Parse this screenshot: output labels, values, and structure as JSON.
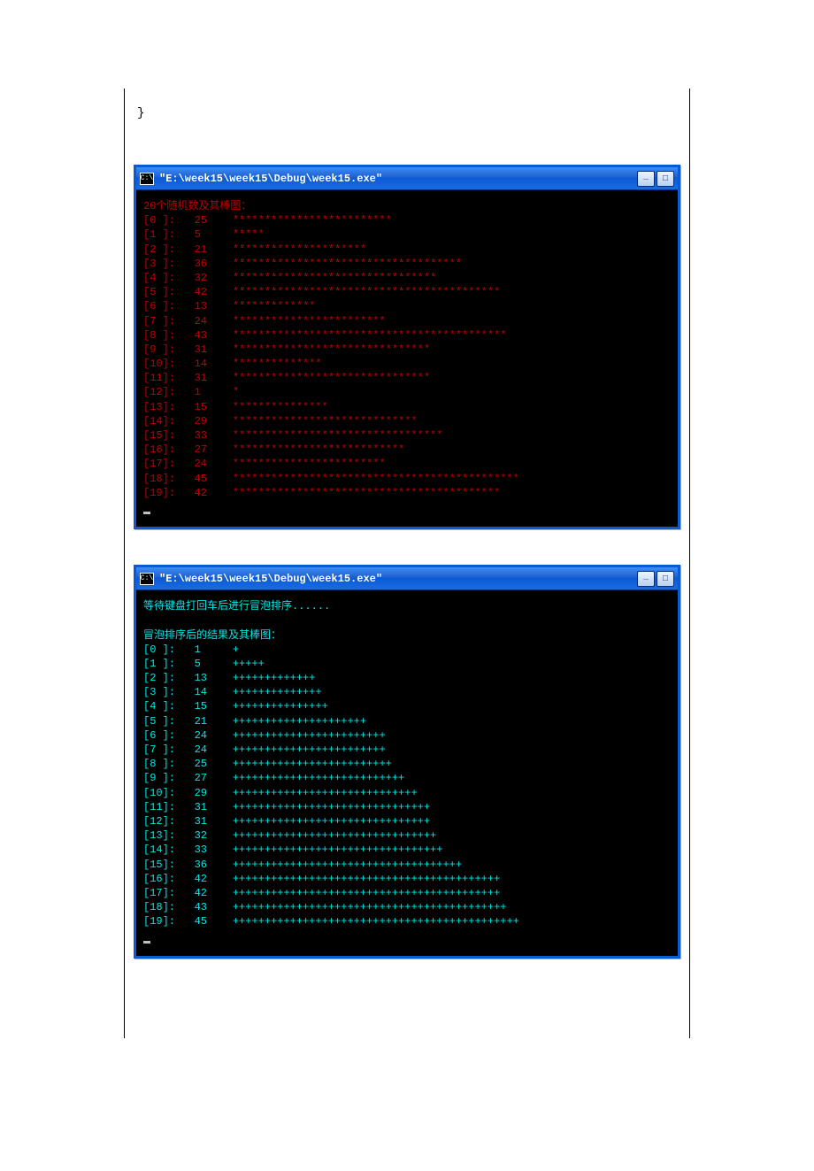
{
  "code_fragment": "}",
  "window_title": "\"E:\\week15\\week15\\Debug\\week15.exe\"",
  "titlebar_icon_text": "C:\\",
  "before_sort": {
    "header": "20个随机数及其棒图：",
    "bar_char": "*",
    "items": [
      {
        "idx": "[0 ]:",
        "val": "25",
        "count": 25
      },
      {
        "idx": "[1 ]:",
        "val": "5",
        "count": 5
      },
      {
        "idx": "[2 ]:",
        "val": "21",
        "count": 21
      },
      {
        "idx": "[3 ]:",
        "val": "36",
        "count": 36
      },
      {
        "idx": "[4 ]:",
        "val": "32",
        "count": 32
      },
      {
        "idx": "[5 ]:",
        "val": "42",
        "count": 42
      },
      {
        "idx": "[6 ]:",
        "val": "13",
        "count": 13
      },
      {
        "idx": "[7 ]:",
        "val": "24",
        "count": 24
      },
      {
        "idx": "[8 ]:",
        "val": "43",
        "count": 43
      },
      {
        "idx": "[9 ]:",
        "val": "31",
        "count": 31
      },
      {
        "idx": "[10]:",
        "val": "14",
        "count": 14
      },
      {
        "idx": "[11]:",
        "val": "31",
        "count": 31
      },
      {
        "idx": "[12]:",
        "val": "1",
        "count": 1
      },
      {
        "idx": "[13]:",
        "val": "15",
        "count": 15
      },
      {
        "idx": "[14]:",
        "val": "29",
        "count": 29
      },
      {
        "idx": "[15]:",
        "val": "33",
        "count": 33
      },
      {
        "idx": "[16]:",
        "val": "27",
        "count": 27
      },
      {
        "idx": "[17]:",
        "val": "24",
        "count": 24
      },
      {
        "idx": "[18]:",
        "val": "45",
        "count": 45
      },
      {
        "idx": "[19]:",
        "val": "42",
        "count": 42
      }
    ]
  },
  "after_sort": {
    "wait_msg": "等待键盘打回车后进行冒泡排序......",
    "header": "冒泡排序后的结果及其棒图：",
    "bar_char": "+",
    "items": [
      {
        "idx": "[0 ]:",
        "val": "1",
        "count": 1
      },
      {
        "idx": "[1 ]:",
        "val": "5",
        "count": 5
      },
      {
        "idx": "[2 ]:",
        "val": "13",
        "count": 13
      },
      {
        "idx": "[3 ]:",
        "val": "14",
        "count": 14
      },
      {
        "idx": "[4 ]:",
        "val": "15",
        "count": 15
      },
      {
        "idx": "[5 ]:",
        "val": "21",
        "count": 21
      },
      {
        "idx": "[6 ]:",
        "val": "24",
        "count": 24
      },
      {
        "idx": "[7 ]:",
        "val": "24",
        "count": 24
      },
      {
        "idx": "[8 ]:",
        "val": "25",
        "count": 25
      },
      {
        "idx": "[9 ]:",
        "val": "27",
        "count": 27
      },
      {
        "idx": "[10]:",
        "val": "29",
        "count": 29
      },
      {
        "idx": "[11]:",
        "val": "31",
        "count": 31
      },
      {
        "idx": "[12]:",
        "val": "31",
        "count": 31
      },
      {
        "idx": "[13]:",
        "val": "32",
        "count": 32
      },
      {
        "idx": "[14]:",
        "val": "33",
        "count": 33
      },
      {
        "idx": "[15]:",
        "val": "36",
        "count": 36
      },
      {
        "idx": "[16]:",
        "val": "42",
        "count": 42
      },
      {
        "idx": "[17]:",
        "val": "42",
        "count": 42
      },
      {
        "idx": "[18]:",
        "val": "43",
        "count": 43
      },
      {
        "idx": "[19]:",
        "val": "45",
        "count": 45
      }
    ]
  }
}
